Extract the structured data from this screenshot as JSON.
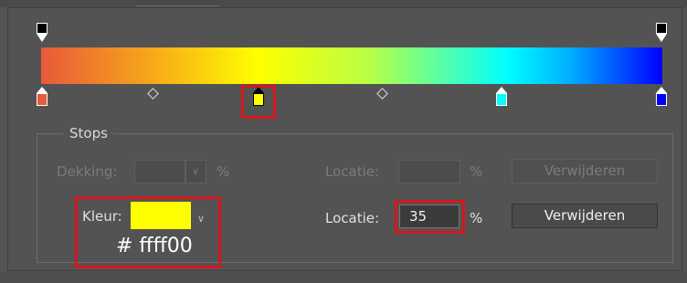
{
  "gradient_editor": {
    "stops_group_title": "Stops",
    "opacity_stops": [
      {
        "name": "left",
        "location": 0
      },
      {
        "name": "right",
        "location": 100
      }
    ],
    "color_stops": [
      {
        "location": 0,
        "color": "#e8593a"
      },
      {
        "location": 35,
        "color": "#ffff00",
        "selected": true
      },
      {
        "location": 75,
        "color": "#00ffff"
      },
      {
        "location": 100,
        "color": "#0000ff"
      }
    ],
    "opacity_row": {
      "opacity_label": "Dekking:",
      "opacity_value": "",
      "opacity_unit": "%",
      "location_label": "Locatie:",
      "location_value": "",
      "location_unit": "%",
      "delete_label": "Verwijderen"
    },
    "color_row": {
      "color_label": "Kleur:",
      "color_value": "#ffff00",
      "location_label": "Locatie:",
      "location_value": "35",
      "location_unit": "%",
      "delete_label": "Verwijderen"
    },
    "hex_annotation": "# ffff00",
    "highlight_color": "#d8161c"
  }
}
